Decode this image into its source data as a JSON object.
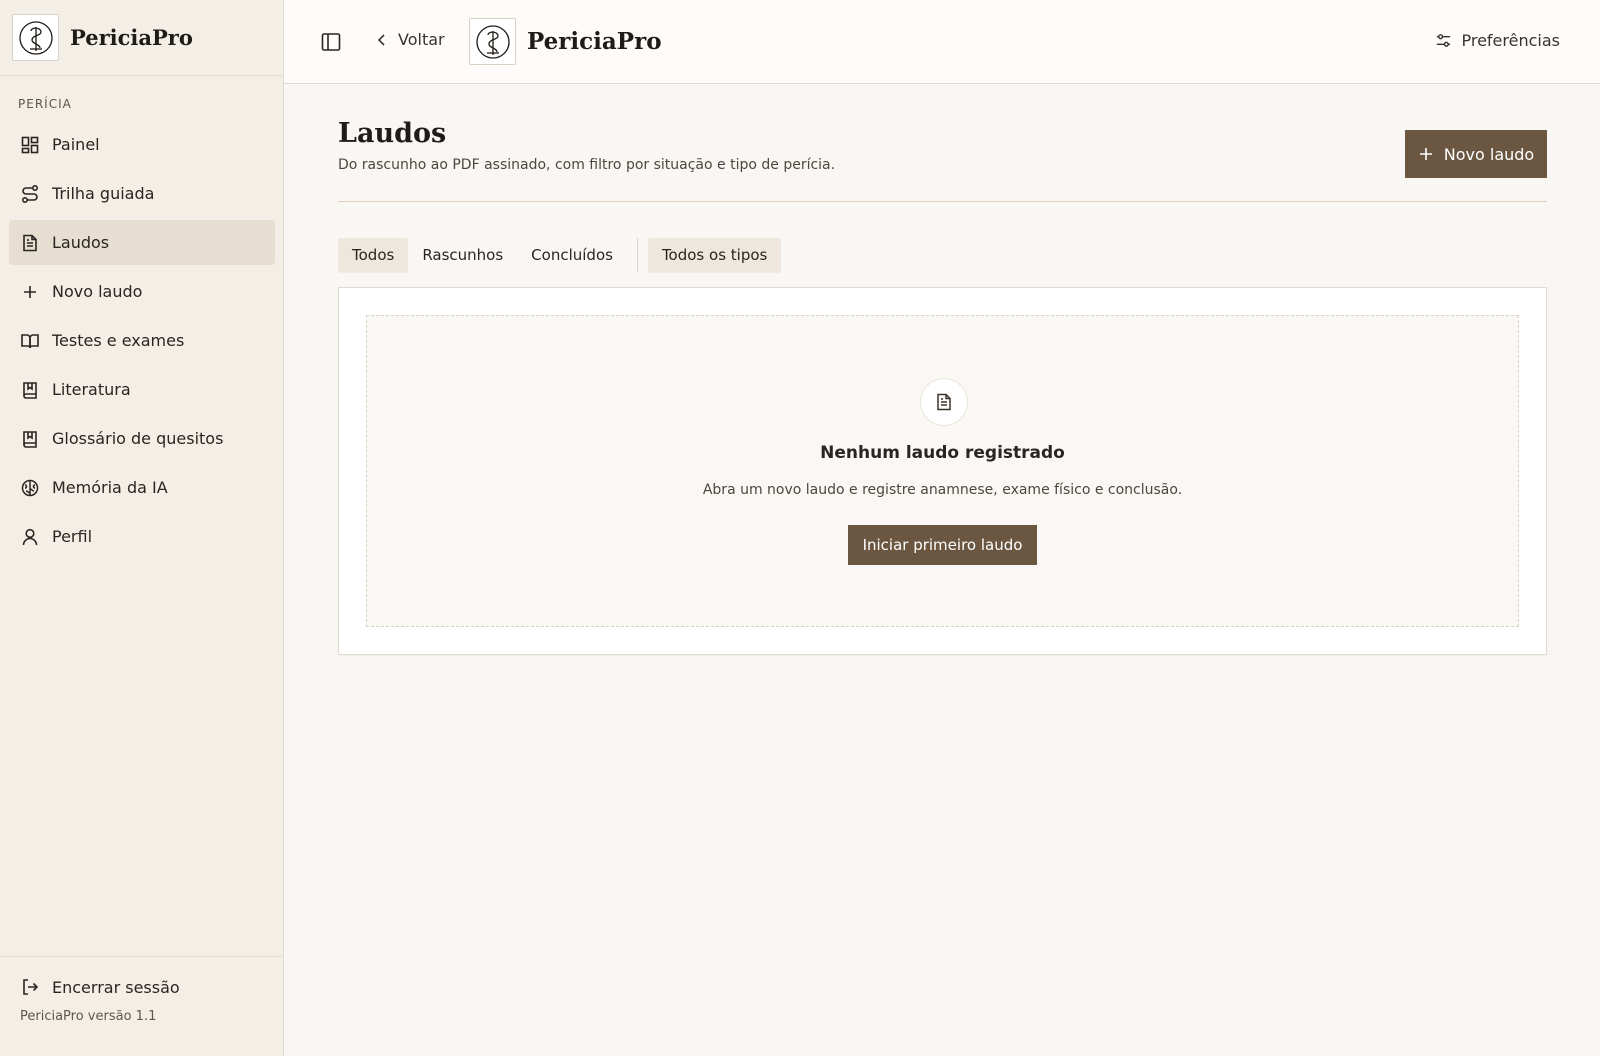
{
  "app": {
    "name": "PericiaPro",
    "version_label": "PericiaPro versão 1.1"
  },
  "sidebar": {
    "section_label": "PERÍCIA",
    "items": [
      {
        "label": "Painel",
        "icon": "dashboard-icon"
      },
      {
        "label": "Trilha guiada",
        "icon": "route-icon"
      },
      {
        "label": "Laudos",
        "icon": "document-icon",
        "active": true
      },
      {
        "label": "Novo laudo",
        "icon": "plus-icon"
      },
      {
        "label": "Testes e exames",
        "icon": "book-open-icon"
      },
      {
        "label": "Literatura",
        "icon": "bookmark-book-icon"
      },
      {
        "label": "Glossário de quesitos",
        "icon": "bookmark-book-icon"
      },
      {
        "label": "Memória da IA",
        "icon": "brain-icon"
      },
      {
        "label": "Perfil",
        "icon": "user-icon"
      }
    ],
    "logout_label": "Encerrar sessão"
  },
  "topbar": {
    "back_label": "Voltar",
    "prefs_label": "Preferências"
  },
  "page": {
    "title": "Laudos",
    "subtitle": "Do rascunho ao PDF assinado, com filtro por situação e tipo de perícia.",
    "new_button_label": "Novo laudo"
  },
  "filters": {
    "status": [
      "Todos",
      "Rascunhos",
      "Concluídos"
    ],
    "type": "Todos os tipos"
  },
  "empty_state": {
    "title": "Nenhum laudo registrado",
    "description": "Abra um novo laudo e registre anamnese, exame físico e conclusão.",
    "button_label": "Iniciar primeiro laudo"
  },
  "colors": {
    "accent": "#6b5741",
    "sidebar_bg": "#f3eee6",
    "active_bg": "#e6ded1"
  }
}
